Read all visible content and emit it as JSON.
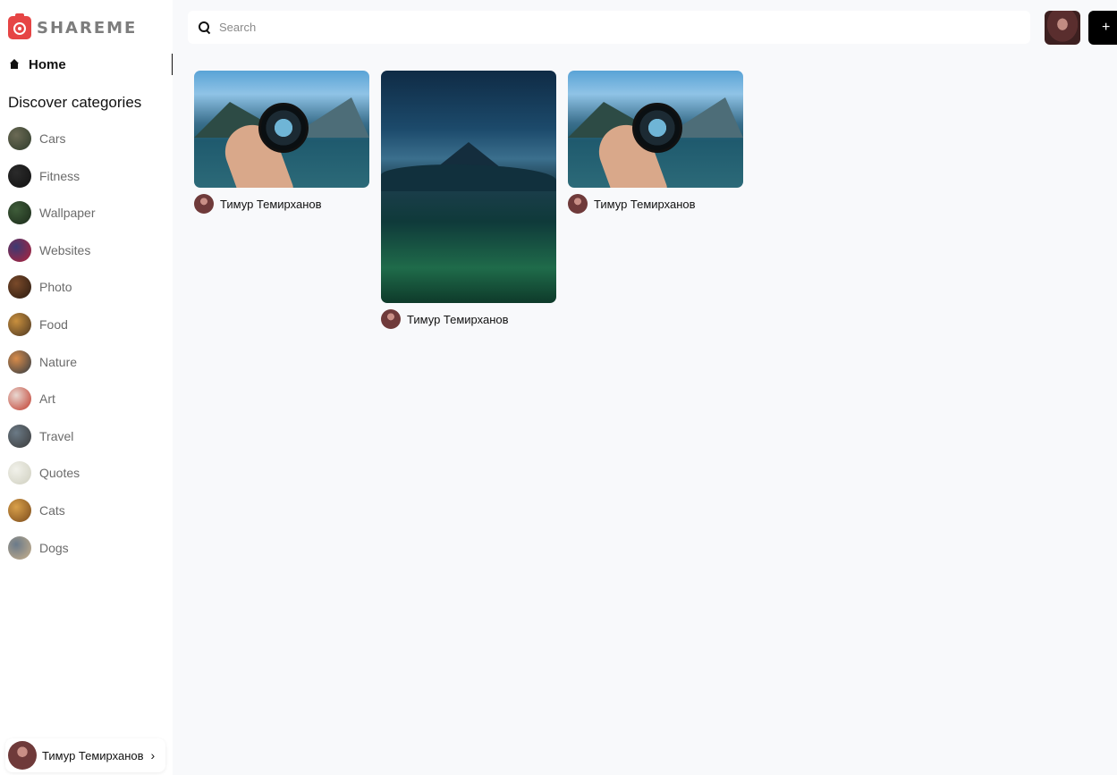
{
  "brand": {
    "name": "SHAREME"
  },
  "nav": {
    "home_label": "Home"
  },
  "sidebar": {
    "discover_title": "Discover categories",
    "categories": [
      {
        "label": "Cars",
        "colors": [
          "#6b6a55",
          "#2f3b2a"
        ]
      },
      {
        "label": "Fitness",
        "colors": [
          "#2b2b2b",
          "#111111"
        ]
      },
      {
        "label": "Wallpaper",
        "colors": [
          "#3f5d3a",
          "#1b2a1a"
        ]
      },
      {
        "label": "Websites",
        "colors": [
          "#3c3a73",
          "#b3223a"
        ]
      },
      {
        "label": "Photo",
        "colors": [
          "#7a4a2a",
          "#2a1a10"
        ]
      },
      {
        "label": "Food",
        "colors": [
          "#c9903e",
          "#4a3520"
        ]
      },
      {
        "label": "Nature",
        "colors": [
          "#d98c4a",
          "#2e3a44"
        ]
      },
      {
        "label": "Art",
        "colors": [
          "#e8d7d0",
          "#c0392b"
        ]
      },
      {
        "label": "Travel",
        "colors": [
          "#6b7a86",
          "#3a3a3a"
        ]
      },
      {
        "label": "Quotes",
        "colors": [
          "#f1f1ea",
          "#cfcfbf"
        ]
      },
      {
        "label": "Cats",
        "colors": [
          "#d9a04a",
          "#7a4a1a"
        ]
      },
      {
        "label": "Dogs",
        "colors": [
          "#6a7a8a",
          "#c9b08a"
        ]
      }
    ]
  },
  "profile": {
    "name": "Тимур Темирханов",
    "chevron": "›"
  },
  "search": {
    "placeholder": "Search"
  },
  "header": {
    "add_label": "+"
  },
  "pins": [
    {
      "author": "Тимур Темирханов",
      "image": "hand-holding-lens-lake"
    },
    {
      "author": "Тимур Темирханов",
      "image": "mountain-night-grass"
    },
    {
      "author": "Тимур Темирханов",
      "image": "hand-holding-lens-lake"
    }
  ]
}
